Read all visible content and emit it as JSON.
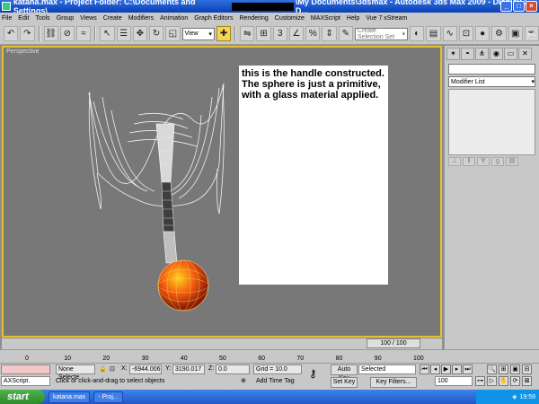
{
  "window": {
    "title_left": "katana.max - Project Folder: C:\\Documents and Settings\\",
    "title_right": "\\My Documents\\3dsmax - Autodesk 3ds Max 2009 - Display : D..."
  },
  "menu": [
    "File",
    "Edit",
    "Tools",
    "Group",
    "Views",
    "Create",
    "Modifiers",
    "Animation",
    "Graph Editors",
    "Rendering",
    "Customize",
    "MAXScript",
    "Help",
    "Vue 7 xStream"
  ],
  "toolbar": {
    "coord_dropdown": "View",
    "selection_set_placeholder": "Create Selection Set"
  },
  "viewport": {
    "label": "Perspective",
    "note_text": "this is the handle constructed. The sphere is just a primitive, with a glass material applied."
  },
  "command_panel": {
    "modifier_list": "Modifier List"
  },
  "timeline": {
    "frame_display": "100 / 100",
    "ticks": [
      "0",
      "10",
      "20",
      "30",
      "40",
      "50",
      "60",
      "70",
      "80",
      "90",
      "100"
    ]
  },
  "status": {
    "selection": "None Selecte",
    "x_label": "X:",
    "x_value": "-6944.006",
    "y_label": "Y:",
    "y_value": "3190.017",
    "z_label": "Z:",
    "z_value": "0.0",
    "grid": "Grid = 10.0",
    "auto_key": "Auto Key",
    "set_key": "Set Key",
    "key_mode": "Selected",
    "key_filters": "Key Filters...",
    "frame": "100",
    "prompt": "Click or click-and-drag to select objects",
    "add_time_tag": "Add Time Tag",
    "maxscript": "AXScript."
  },
  "taskbar": {
    "start": "start",
    "item1": "katana.max",
    "item2": "- Proj...",
    "clock": "19:59"
  }
}
